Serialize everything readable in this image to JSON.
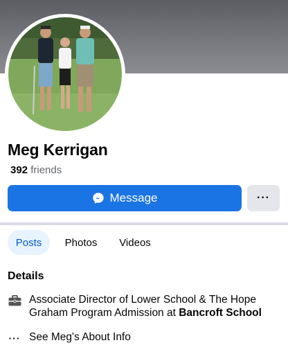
{
  "profile": {
    "name": "Meg Kerrigan",
    "friends_count": "392",
    "friends_label": "friends"
  },
  "actions": {
    "message_label": "Message",
    "more_label": "···"
  },
  "tabs": [
    {
      "label": "Posts",
      "active": true
    },
    {
      "label": "Photos",
      "active": false
    },
    {
      "label": "Videos",
      "active": false
    }
  ],
  "details": {
    "title": "Details",
    "work": {
      "prefix": "Associate Director of Lower School & The Hope Graham Program Admission at ",
      "organization": "Bancroft School",
      "icon": "briefcase-icon"
    },
    "about": {
      "label": "See Meg's About Info",
      "icon": "more-dots-icon"
    }
  },
  "colors": {
    "accent": "#1b74e4",
    "active_tab_bg": "#e7f3ff",
    "active_tab_text": "#0a58ca",
    "secondary_button": "#e4e6eb"
  }
}
